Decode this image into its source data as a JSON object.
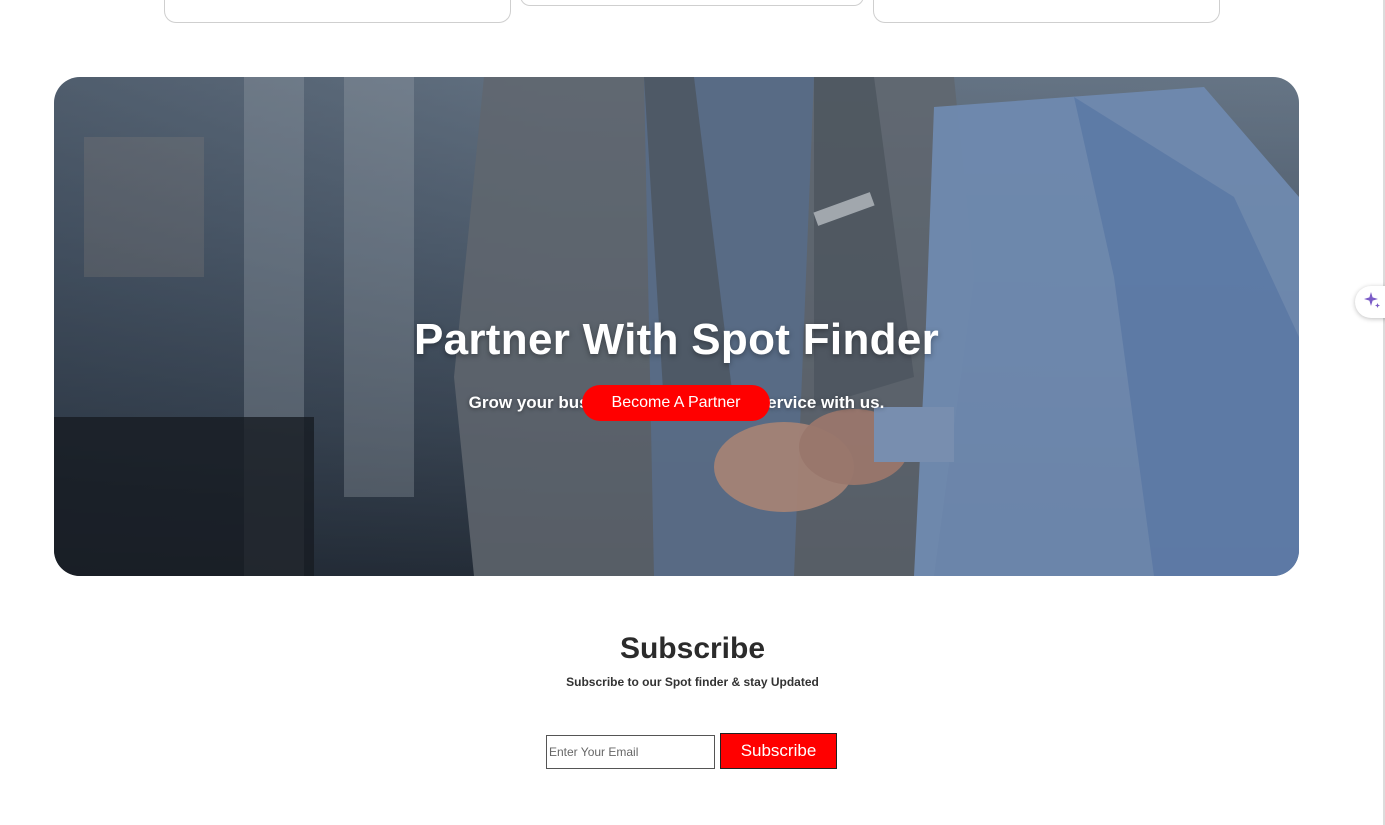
{
  "hero": {
    "title": "Partner With Spot Finder",
    "subtitle": "Grow your business by listing your service with us.",
    "cta_label": "Become A Partner"
  },
  "subscribe": {
    "title": "Subscribe",
    "description": "Subscribe to our Spot finder & stay Updated",
    "email_placeholder": "Enter Your Email",
    "button_label": "Subscribe"
  },
  "colors": {
    "accent": "#ff0000",
    "ai_icon": "#7b5cc7"
  },
  "icons": {
    "assistant": "sparkle-icon"
  }
}
